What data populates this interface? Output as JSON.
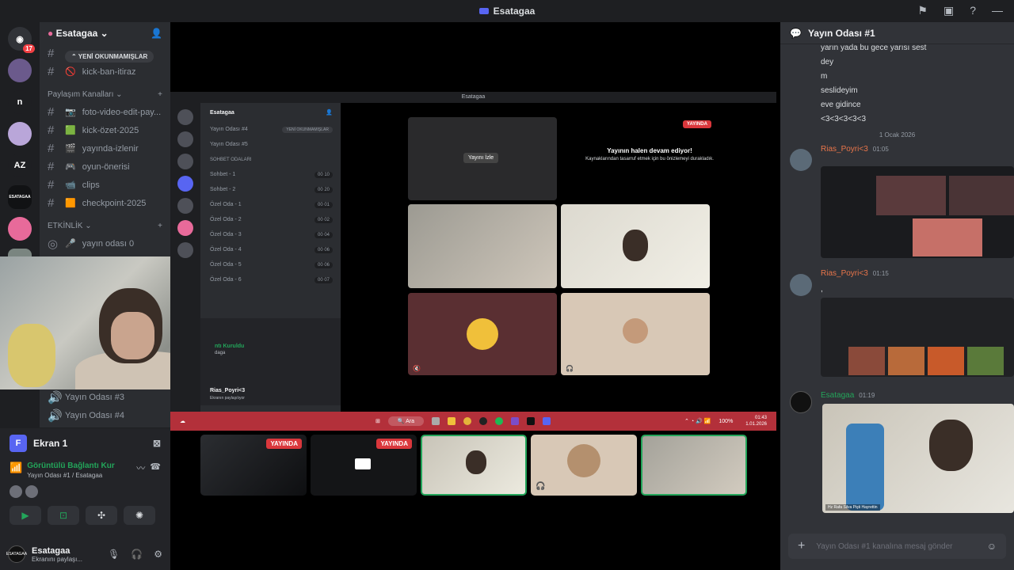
{
  "window": {
    "title": "Esatagaa",
    "icons": [
      "flag-icon",
      "inbox-icon",
      "help-icon",
      "minimize-icon"
    ]
  },
  "guilds": [
    {
      "label": "",
      "color": "#313338",
      "badge": "17",
      "icon": "discord-home-icon"
    },
    {
      "label": "",
      "color": "#6b5a8c",
      "badge": ""
    },
    {
      "label": "n",
      "color": "#1e1f22",
      "badge": ""
    },
    {
      "label": "",
      "color": "#b9a6d9",
      "badge": ""
    },
    {
      "label": "AZ",
      "color": "#1e1f22",
      "badge": ""
    },
    {
      "label": "ESATAGAA",
      "color": "#111214",
      "badge": ""
    },
    {
      "label": "",
      "color": "#e86a9a",
      "badge": ""
    },
    {
      "label": "",
      "color": "#7a8580",
      "badge": ""
    },
    {
      "label": "",
      "color": "#9b9da1",
      "badge": ""
    }
  ],
  "sidebar": {
    "server_name": "Esatagaa",
    "unread_pill": "YENİ OKUNMAMIŞLAR",
    "top_channels": [
      {
        "icon": "🚫",
        "label": "kick-ban-itiraz"
      }
    ],
    "categories": [
      {
        "name": "Paylaşım Kanalları",
        "channels": [
          {
            "icon": "📷",
            "label": "foto-video-edit-pay..."
          },
          {
            "icon": "🟩",
            "label": "kick-özet-2025"
          },
          {
            "icon": "🎬",
            "label": "yayında-izlenir"
          },
          {
            "icon": "🎮",
            "label": "oyun-önerisi"
          },
          {
            "icon": "📹",
            "label": "clips"
          },
          {
            "icon": "🟧",
            "label": "checkpoint-2025"
          }
        ]
      },
      {
        "name": "ETKİNLİK",
        "channels": [
          {
            "icon": "🎤",
            "label": "yayın odası 0"
          }
        ]
      }
    ],
    "lower_channels": [
      {
        "label": "Yayın Odası #3"
      },
      {
        "label": "Yayın Odası #4"
      }
    ]
  },
  "voice": {
    "screen_label": "Ekran 1",
    "status": "Görüntülü Bağlantı Kur",
    "room": "Yayın Odası #1 / Esatagaa"
  },
  "user": {
    "name": "Esatagaa",
    "status": "Ekranını paylaşı...",
    "avatar_text": "ESATAGAA"
  },
  "inner_app": {
    "title": "Esatagaa",
    "server": "Esatagaa",
    "unread": "YENİ OKUNMAMIŞLAR",
    "channels": [
      {
        "label": "Yayın Odası #4",
        "count": ""
      },
      {
        "label": "Yayın Odası #5",
        "count": ""
      }
    ],
    "category": "SOHBET ODALARI",
    "voice_channels": [
      {
        "label": "Sohbet - 1",
        "count": "00 10"
      },
      {
        "label": "Sohbet - 2",
        "count": "00 20"
      },
      {
        "label": "Özel Oda - 1",
        "count": "00 01"
      },
      {
        "label": "Özel Oda - 2",
        "count": "00 02"
      },
      {
        "label": "Özel Oda - 3",
        "count": "00 04"
      },
      {
        "label": "Özel Oda - 4",
        "count": "00 06"
      },
      {
        "label": "Özel Oda - 5",
        "count": "00 06"
      },
      {
        "label": "Özel Oda - 6",
        "count": "00 07"
      }
    ],
    "conn_text": "ntı Kuruldu",
    "conn_sub": "daga",
    "user_name": "Rias_Poyri<3",
    "user_status": "Ekranın paylaşılıyor",
    "watch_label": "Yayını İzle",
    "live_badge": "YAYINDA",
    "stream_title": "Yayının halen devam ediyor!",
    "stream_sub": "Kaynaklarından tasarruf etmek için bu önizlemeyi durakladık."
  },
  "taskbar": {
    "search": "Ara",
    "battery": "100%",
    "time": "01:43",
    "date": "1.01.2026"
  },
  "strip": {
    "live_badge": "YAYINDA"
  },
  "chat": {
    "channel": "Yayın Odası #1",
    "lines": [
      "yarın yada bu gece yarısı sest",
      "dey",
      "m",
      "seslideyim",
      "eve gidince",
      "<3<3<3<3<3"
    ],
    "date_divider": "1 Ocak 2026",
    "messages": [
      {
        "author": "Rias_Poyri<3",
        "time": "01:05"
      },
      {
        "author": "Rias_Poyri<3",
        "time": "01:15",
        "text": ","
      },
      {
        "author": "Esatagaa",
        "time": "01:19"
      }
    ],
    "attachment_caption": "Hz Rafa Silva Pişti Hayrettin",
    "placeholder": "Yayın Odası #1 kanalına mesaj gönder"
  },
  "colors": {
    "accent": "#5865f2",
    "live": "#da373c",
    "online": "#23a55a",
    "taskbar": "#b3303a"
  }
}
